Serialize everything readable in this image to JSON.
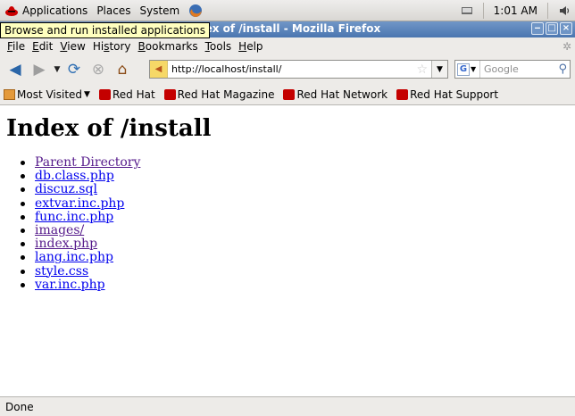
{
  "panel": {
    "applications": "Applications",
    "places": "Places",
    "system": "System",
    "clock": "1:01 AM"
  },
  "tooltip": "Browse and run installed applications",
  "window": {
    "title": "Index of /install - Mozilla Firefox"
  },
  "menu": [
    "File",
    "Edit",
    "View",
    "History",
    "Bookmarks",
    "Tools",
    "Help"
  ],
  "navigation": {
    "url": "http://localhost/install/",
    "search_placeholder": "Google"
  },
  "bookmarks": {
    "most_visited": "Most Visited",
    "items": [
      "Red Hat",
      "Red Hat Magazine",
      "Red Hat Network",
      "Red Hat Support"
    ]
  },
  "page": {
    "heading": "Index of /install",
    "entries": [
      {
        "name": "Parent Directory",
        "visited": true
      },
      {
        "name": "db.class.php",
        "visited": false
      },
      {
        "name": "discuz.sql",
        "visited": false
      },
      {
        "name": "extvar.inc.php",
        "visited": false
      },
      {
        "name": "func.inc.php",
        "visited": false
      },
      {
        "name": "images/",
        "visited": true
      },
      {
        "name": "index.php",
        "visited": true
      },
      {
        "name": "lang.inc.php",
        "visited": false
      },
      {
        "name": "style.css",
        "visited": false
      },
      {
        "name": "var.inc.php",
        "visited": false
      }
    ]
  },
  "status": "Done",
  "colors": {
    "visited_link": "#551a8b",
    "unvisited_link": "#0000ee",
    "titlebar": "#5a84bb"
  }
}
